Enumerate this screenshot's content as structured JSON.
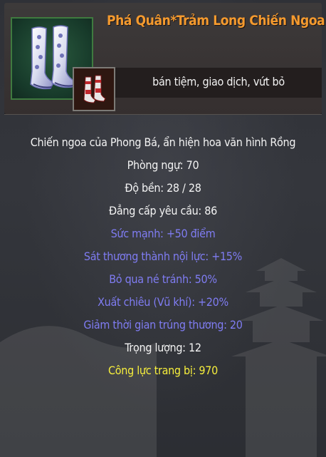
{
  "item": {
    "name": "Phá Quân*Trảm Long Chiến Ngoa",
    "name_color": "#f49a2e",
    "icon": "boots-icon",
    "sub_icon": "boots-small-icon",
    "actions": "bán tiệm, giao dịch, vứt bỏ"
  },
  "stats": [
    {
      "text": "Chiến ngoa của Phong Bá, ẩn hiện hoa văn hình Rồng",
      "color": "white"
    },
    {
      "text": "Phòng ngự: 70",
      "color": "white"
    },
    {
      "text": "Độ bền:  28 /  28",
      "color": "white"
    },
    {
      "text": "Đẳng cấp yêu cầu: 86",
      "color": "white"
    },
    {
      "text": "Sức mạnh: +50 điểm",
      "color": "blue"
    },
    {
      "text": "Sát thương thành nội lực: +15%",
      "color": "blue"
    },
    {
      "text": "Bỏ qua né tránh: 50%",
      "color": "blue"
    },
    {
      "text": "Xuất chiêu (Vũ khí): +20%",
      "color": "blue"
    },
    {
      "text": "Giảm thời gian trúng thương: 20",
      "color": "blue"
    },
    {
      "text": "Trọng lượng: 12",
      "color": "white"
    },
    {
      "text": "Công lực trang bị: 970",
      "color": "yellow"
    }
  ],
  "colors": {
    "white": "#f3f3f3",
    "blue": "#7f7cf2",
    "yellow": "#f6ee3c"
  }
}
